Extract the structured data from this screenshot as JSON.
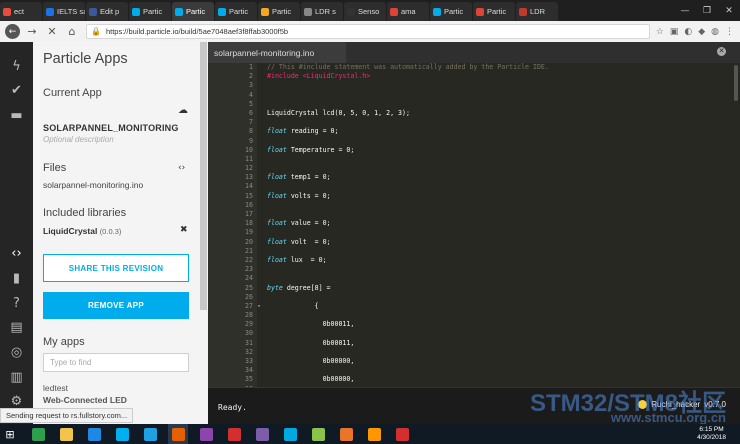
{
  "browser": {
    "tabs": [
      {
        "label": "ect",
        "color": "#e94b3c"
      },
      {
        "label": "IELTS sam",
        "color": "#1a73e8"
      },
      {
        "label": "Edit p",
        "color": "#3b5998"
      },
      {
        "label": "Partic",
        "color": "#00acec"
      },
      {
        "label": "Partic",
        "color": "#00acec"
      },
      {
        "label": "Partic",
        "color": "#00acec"
      },
      {
        "label": "Partic",
        "color": "#f5a623"
      },
      {
        "label": "LDR s",
        "color": "#888888"
      },
      {
        "label": "Senso",
        "color": "#333333"
      },
      {
        "label": "ama",
        "color": "#db4437"
      },
      {
        "label": "Partic",
        "color": "#00acec"
      },
      {
        "label": "Partic",
        "color": "#db4437"
      },
      {
        "label": "LDR",
        "color": "#c0392b"
      }
    ],
    "active_tab": 4,
    "window_controls": {
      "minimize": "—",
      "maximize": "❐",
      "close": "✕"
    },
    "url": "https://build.particle.io/build/5ae7048aef3f8ffab3000f5b",
    "status_popup": "Sending request to rs.fullstory.com..."
  },
  "rail": {
    "icons": [
      "flash-icon",
      "verify-icon",
      "folder-icon",
      "code-icon",
      "bookmark-icon",
      "help-icon",
      "docs-icon",
      "target-icon",
      "chart-icon",
      "settings-icon"
    ]
  },
  "sidebar": {
    "title": "Particle Apps",
    "current_app_heading": "Current App",
    "app_name": "SOLARPANNEL_MONITORING",
    "app_description_placeholder": "Optional description",
    "files_heading": "Files",
    "file_name": "solarpannel-monitoring.ino",
    "libraries_heading": "Included libraries",
    "library_name": "LiquidCrystal",
    "library_version": "(0.0.3)",
    "share_label": "SHARE THIS REVISION",
    "remove_label": "REMOVE APP",
    "my_apps_heading": "My apps",
    "search_placeholder": "Type to find",
    "apps": [
      "ledtest",
      "Web-Connected LED"
    ]
  },
  "editor": {
    "file_tab": "solarpannel-monitoring.ino",
    "lines": [
      {
        "n": "1",
        "text": "// This #include statement was automatically added by the Particle IDE.",
        "kind": "comment"
      },
      {
        "n": "2",
        "text": "#include <LiquidCrystal.h>",
        "kind": "directive"
      },
      {
        "n": "3",
        "text": "",
        "kind": "plain"
      },
      {
        "n": "4",
        "text": "",
        "kind": "plain"
      },
      {
        "n": "5",
        "text": "",
        "kind": "plain"
      },
      {
        "n": "6",
        "text": "LiquidCrystal lcd(0, 5, 0, 1, 2, 3);",
        "kind": "plain"
      },
      {
        "n": "7",
        "text": "",
        "kind": "plain"
      },
      {
        "n": "8",
        "text": "float reading = 0;",
        "kind": "plain"
      },
      {
        "n": "9",
        "text": "",
        "kind": "plain"
      },
      {
        "n": "10",
        "text": "float Temperature = 0;",
        "kind": "plain"
      },
      {
        "n": "11",
        "text": "",
        "kind": "plain"
      },
      {
        "n": "12",
        "text": "",
        "kind": "plain"
      },
      {
        "n": "13",
        "text": "float temp1 = 0;",
        "kind": "plain"
      },
      {
        "n": "14",
        "text": "",
        "kind": "plain"
      },
      {
        "n": "15",
        "text": "float volts = 0;",
        "kind": "plain"
      },
      {
        "n": "16",
        "text": "",
        "kind": "plain"
      },
      {
        "n": "17",
        "text": "",
        "kind": "plain"
      },
      {
        "n": "18",
        "text": "float value = 0;",
        "kind": "plain"
      },
      {
        "n": "19",
        "text": "",
        "kind": "plain"
      },
      {
        "n": "20",
        "text": "float volt  = 0;",
        "kind": "plain"
      },
      {
        "n": "21",
        "text": "",
        "kind": "plain"
      },
      {
        "n": "22",
        "text": "float lux  = 0;",
        "kind": "plain"
      },
      {
        "n": "23",
        "text": "",
        "kind": "plain"
      },
      {
        "n": "24",
        "text": "",
        "kind": "plain"
      },
      {
        "n": "25",
        "text": "byte degree[8] =",
        "kind": "plain"
      },
      {
        "n": "26",
        "text": "",
        "kind": "plain"
      },
      {
        "n": "27",
        "text": "            {",
        "kind": "plain",
        "fold": "▾"
      },
      {
        "n": "28",
        "text": "",
        "kind": "plain"
      },
      {
        "n": "29",
        "text": "              0b00011,",
        "kind": "plain"
      },
      {
        "n": "30",
        "text": "",
        "kind": "plain"
      },
      {
        "n": "31",
        "text": "              0b00011,",
        "kind": "plain"
      },
      {
        "n": "32",
        "text": "",
        "kind": "plain"
      },
      {
        "n": "33",
        "text": "              0b00000,",
        "kind": "plain"
      },
      {
        "n": "34",
        "text": "",
        "kind": "plain"
      },
      {
        "n": "35",
        "text": "              0b00000,",
        "kind": "plain"
      },
      {
        "n": "36",
        "text": "",
        "kind": "plain"
      }
    ],
    "console_text": "Ready.",
    "device_name": "Ruchi_hacker",
    "device_version": "v0.7.0"
  },
  "watermark": {
    "line1": "STM32/STM8社区",
    "line2": "www.stmcu.org.cn"
  },
  "taskbar": {
    "apps": [
      {
        "name": "start-icon",
        "color": "#ffffff"
      },
      {
        "name": "store-icon",
        "color": "#2d9f4d"
      },
      {
        "name": "explorer-icon",
        "color": "#f3c44b"
      },
      {
        "name": "defender-icon",
        "color": "#1e88e5"
      },
      {
        "name": "skype-icon",
        "color": "#00aff0"
      },
      {
        "name": "ie-icon",
        "color": "#1ea0e2"
      },
      {
        "name": "firefox-icon",
        "color": "#e66000"
      },
      {
        "name": "visualstudio-icon",
        "color": "#8e44ad"
      },
      {
        "name": "foxit-icon",
        "color": "#d32f2f"
      },
      {
        "name": "app-icon",
        "color": "#7b5ea7"
      },
      {
        "name": "c-icon",
        "color": "#00a9e0"
      },
      {
        "name": "notepad-icon",
        "color": "#8bc34a"
      },
      {
        "name": "matlab-icon",
        "color": "#e8752a"
      },
      {
        "name": "sublime-icon",
        "color": "#ff9800"
      },
      {
        "name": "maps-icon",
        "color": "#d32f2f"
      }
    ],
    "time": "6:15 PM",
    "date": "4/30/2018"
  }
}
